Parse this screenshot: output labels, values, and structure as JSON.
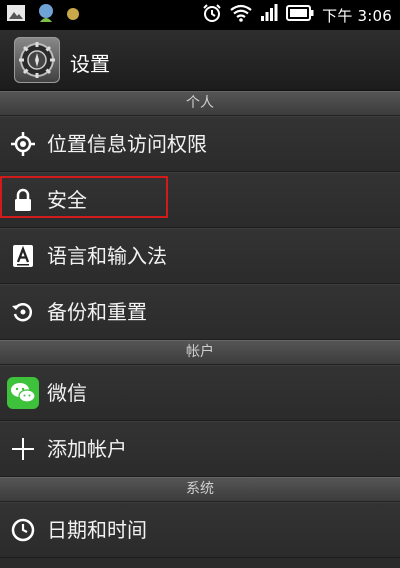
{
  "status_bar": {
    "time": "下午 3:06",
    "left_icons": [
      "gallery-icon",
      "android-icon",
      "coin-icon"
    ],
    "right_icons": [
      "alarm-icon",
      "wifi-icon",
      "signal-icon",
      "battery-icon"
    ]
  },
  "header": {
    "title": "设置",
    "app_icon": "settings-gear-icon"
  },
  "sections": [
    {
      "title": "个人",
      "items": [
        {
          "label": "位置信息访问权限",
          "icon": "location-icon"
        },
        {
          "label": "安全",
          "icon": "lock-icon"
        },
        {
          "label": "语言和输入法",
          "icon": "keyboard-a-icon"
        },
        {
          "label": "备份和重置",
          "icon": "backup-restore-icon"
        }
      ]
    },
    {
      "title": "帐户",
      "items": [
        {
          "label": "微信",
          "icon": "wechat-icon"
        },
        {
          "label": "添加帐户",
          "icon": "plus-icon"
        }
      ]
    },
    {
      "title": "系统",
      "items": [
        {
          "label": "日期和时间",
          "icon": "clock-icon"
        }
      ]
    }
  ],
  "colors": {
    "highlight_border": "#d11a1a",
    "wechat_green": "#3ec13b"
  }
}
